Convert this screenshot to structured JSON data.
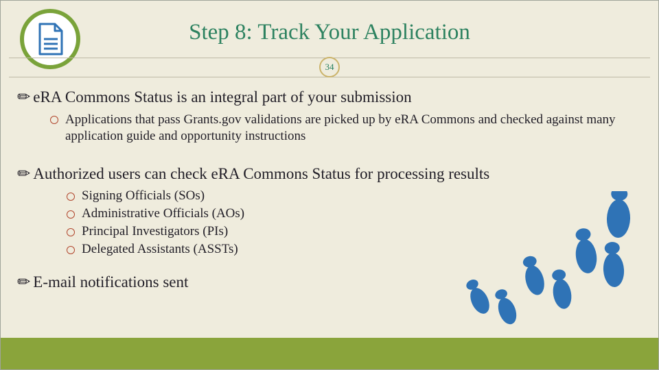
{
  "page_number": "34",
  "title": "Step 8: Track Your Application",
  "bullets": {
    "b1": "eRA Commons Status is an integral part of your submission",
    "b1_1": "Applications that pass Grants.gov validations are picked up by eRA Commons and checked against many application guide and opportunity instructions",
    "b2": "Authorized users can check eRA Commons Status for processing results",
    "b2_1": "Signing Officials (SOs)",
    "b2_2": "Administrative Officials (AOs)",
    "b2_3": "Principal Investigators (PIs)",
    "b2_4": "Delegated Assistants (ASSTs)",
    "b3": "E-mail notifications sent"
  },
  "colors": {
    "accent_green": "#7aa33a",
    "title_teal": "#2d8260",
    "bullet_ring": "#b1452c",
    "footprint": "#2f73b6"
  }
}
